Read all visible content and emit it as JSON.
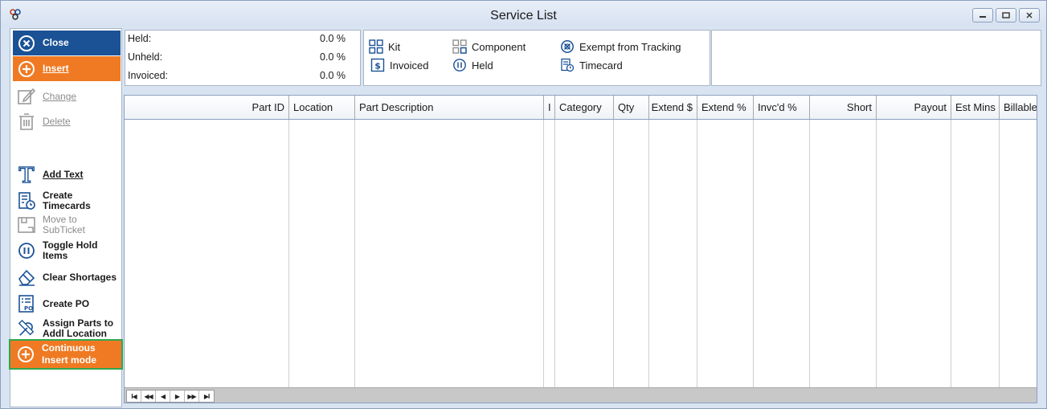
{
  "window": {
    "title": "Service List",
    "controls": {
      "minimize": "▭",
      "restore": "▣",
      "close": "✕"
    }
  },
  "toolbar": {
    "close": "Close",
    "insert": "Insert",
    "change": "Change",
    "delete": "Delete",
    "add_text": "Add Text",
    "create_timecards": "Create Timecards",
    "move_to_subticket_1": "Move to",
    "move_to_subticket_2": "SubTicket",
    "toggle_hold_1": "Toggle Hold",
    "toggle_hold_2": "Items",
    "clear_shortages": "Clear Shortages",
    "create_po": "Create PO",
    "assign_parts_1": "Assign Parts to",
    "assign_parts_2": "Addl Location",
    "continuous_1": "Continuous",
    "continuous_2": "Insert mode"
  },
  "summary": {
    "held_label": "Held:",
    "held_value": "0.0 %",
    "unheld_label": "Unheld:",
    "unheld_value": "0.0 %",
    "invoiced_label": "Invoiced:",
    "invoiced_value": "0.0 %"
  },
  "legend": {
    "kit": "Kit",
    "component": "Component",
    "exempt": "Exempt from Tracking",
    "invoiced": "Invoiced",
    "held": "Held",
    "timecard": "Timecard"
  },
  "grid": {
    "columns": [
      {
        "key": "part_id",
        "label": "Part ID"
      },
      {
        "key": "location",
        "label": "Location"
      },
      {
        "key": "part_description",
        "label": "Part Description"
      },
      {
        "key": "i",
        "label": "I"
      },
      {
        "key": "category",
        "label": "Category"
      },
      {
        "key": "qty",
        "label": "Qty"
      },
      {
        "key": "extend_dollar",
        "label": "Extend $"
      },
      {
        "key": "extend_pct",
        "label": "Extend %"
      },
      {
        "key": "invcd_pct",
        "label": "Invc'd %"
      },
      {
        "key": "short",
        "label": "Short"
      },
      {
        "key": "payout",
        "label": "Payout"
      },
      {
        "key": "est_mins",
        "label": "Est Mins"
      },
      {
        "key": "billable",
        "label": "Billable"
      }
    ],
    "rows": [],
    "nav": [
      "I◀",
      "◀◀",
      "◀",
      "▶",
      "▶▶",
      "▶I"
    ]
  },
  "colors": {
    "accent_blue": "#1b5296",
    "accent_orange": "#ef7a23",
    "highlight_green": "#2fa84f",
    "icon_blue": "#1b5296"
  }
}
